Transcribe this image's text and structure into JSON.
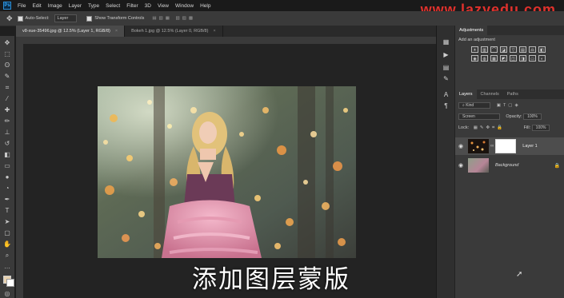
{
  "menu": {
    "logo": "Ps",
    "items": [
      "File",
      "Edit",
      "Image",
      "Layer",
      "Type",
      "Select",
      "Filter",
      "3D",
      "View",
      "Window",
      "Help"
    ]
  },
  "watermark": "www.lazyedu.com",
  "options": {
    "auto_select_label": "Auto-Select:",
    "auto_select_value": "Layer",
    "show_transform_label": "Show Transform Controls"
  },
  "tabs": [
    {
      "label": "v8-xue-35496.jpg @ 12.5% (Layer 1, RGB/8)",
      "active": true
    },
    {
      "label": "Bokeh 1.jpg @ 12.5% (Layer 0, RGB/8)",
      "active": false
    }
  ],
  "subtitle": "添加图层蒙版",
  "panels": {
    "adjustments_tab": "Adjustments",
    "adjustments_subtitle": "Add an adjustment",
    "layers_tabs": [
      "Layers",
      "Channels",
      "Paths"
    ],
    "kind_label": "Kind",
    "blend_mode": "Screen",
    "opacity_label": "Opacity:",
    "opacity_value": "100%",
    "lock_label": "Lock:",
    "fill_label": "Fill:",
    "fill_value": "100%",
    "layers": [
      {
        "name": "Layer 1",
        "locked": false
      },
      {
        "name": "Background",
        "locked": true
      }
    ]
  }
}
